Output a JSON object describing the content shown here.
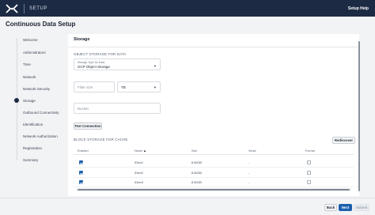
{
  "topbar": {
    "title": "SETUP",
    "help": "Setup Help"
  },
  "page": {
    "title": "Continuous Data Setup"
  },
  "steps": [
    {
      "label": "Welcome",
      "active": false
    },
    {
      "label": "Administrators",
      "active": false
    },
    {
      "label": "Time",
      "active": false
    },
    {
      "label": "Network",
      "active": false
    },
    {
      "label": "Network Security",
      "active": false
    },
    {
      "label": "Storage",
      "active": true
    },
    {
      "label": "Outbound Connectivity",
      "active": false
    },
    {
      "label": "Identification",
      "active": false
    },
    {
      "label": "Network Authorization",
      "active": false
    },
    {
      "label": "Registration",
      "active": false
    },
    {
      "label": "Summary",
      "active": false
    }
  ],
  "storage": {
    "section_title": "Storage",
    "object_heading": "OBJECT STORAGE FOR DATA",
    "storage_type": {
      "label": "Storage Type for Data",
      "value": "GCP Object Storage"
    },
    "size": {
      "placeholder": "Filter size"
    },
    "unit": {
      "value": "TB"
    },
    "bucket": {
      "placeholder": "Bucket"
    },
    "test_button": "Test Connection",
    "block_heading": "BLOCK STORAGE FOR CACHE",
    "rediscover_button": "Rediscover",
    "columns": [
      "Enabled",
      "Name",
      "Size",
      "Serial",
      "Format"
    ],
    "rows": [
      {
        "enabled": true,
        "name": "/Dev/1",
        "size": "8.00GB",
        "serial": "-",
        "format": false
      },
      {
        "enabled": true,
        "name": "/Dev/2",
        "size": "8.00GB",
        "serial": "-",
        "format": false
      },
      {
        "enabled": true,
        "name": "/Dev/4",
        "size": "8.00GB",
        "serial": "-",
        "format": false
      }
    ]
  },
  "footer": {
    "back": "Back",
    "next": "Next",
    "submit": "Submit"
  },
  "colors": {
    "topbar": "#1d2a44",
    "primary": "#1b5fae"
  }
}
